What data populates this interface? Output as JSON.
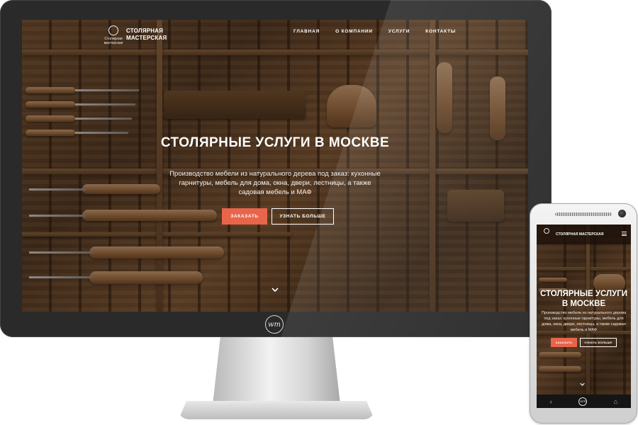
{
  "site": {
    "logo_text": "Столярная мастерская",
    "brand_line1": "СТОЛЯРНАЯ",
    "brand_line2": "МАСТЕРСКАЯ",
    "brand_mobile": "СТОЛЯРНАЯ МАСТЕРСКАЯ",
    "nav": [
      "ГЛАВНАЯ",
      "О КОМПАНИИ",
      "УСЛУГИ",
      "КОНТАКТЫ"
    ],
    "hero_title": "СТОЛЯРНЫЕ УСЛУГИ В МОСКВЕ",
    "hero_subtitle": "Производство мебели из натурального дерева под заказ: кухонные гарнитуры, мебель для дома, окна, двери, лестницы, а также садовая мебель и МАФ",
    "btn_order": "ЗАКАЗАТЬ",
    "btn_more": "УЗНАТЬ БОЛЬШЕ"
  },
  "device_logo": "wm",
  "colors": {
    "accent": "#e8654a",
    "bezel": "#2a2a2a",
    "overlay": "#281a0e"
  },
  "icons": [
    "chevron-down-icon",
    "hamburger-menu-icon",
    "back-icon",
    "home-icon"
  ]
}
